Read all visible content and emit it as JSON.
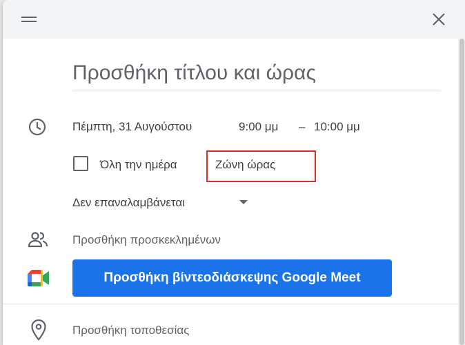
{
  "dialog": {
    "title_placeholder": "Προσθήκη τίτλου και ώρας"
  },
  "datetime": {
    "date": "Πέμπτη, 31 Αυγούστου",
    "start_time": "9:00 μμ",
    "separator": "–",
    "end_time": "10:00 μμ"
  },
  "options": {
    "all_day_label": "Όλη την ημέρα",
    "timezone_label": "Ζώνη ώρας",
    "recurrence_value": "Δεν επαναλαμβάνεται"
  },
  "guests": {
    "placeholder": "Προσθήκη προσκεκλημένων"
  },
  "meet": {
    "button_label": "Προσθήκη βίντεοδιάσκεψης Google Meet"
  },
  "location": {
    "placeholder": "Προσθήκη τοποθεσίας"
  },
  "icons": {
    "drag": "drag-handle-icon",
    "close": "close-icon",
    "time": "clock-icon",
    "guests": "people-icon",
    "meet": "google-meet-icon",
    "location": "location-pin-icon"
  },
  "colors": {
    "accent": "#1a73e8",
    "highlight": "#d93025"
  }
}
